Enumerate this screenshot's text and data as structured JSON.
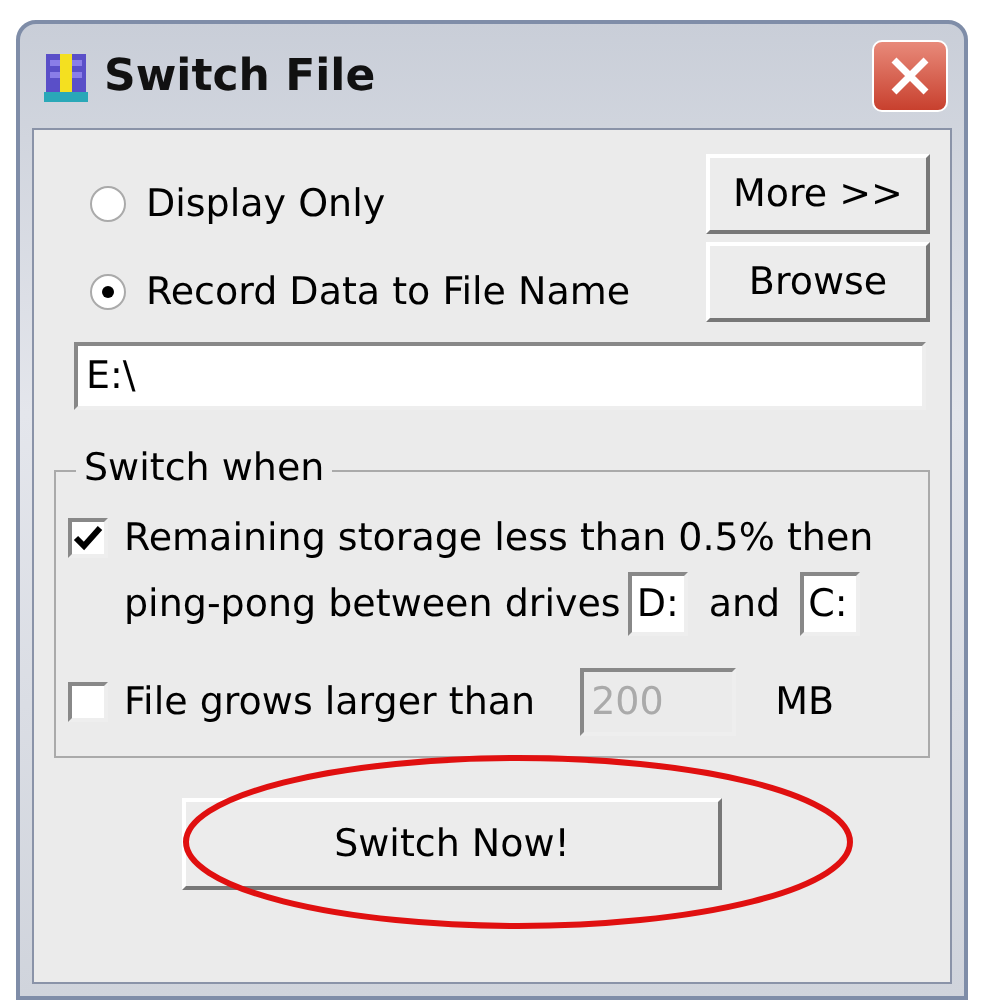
{
  "window": {
    "title": "Switch File"
  },
  "modes": [
    {
      "label": "Display Only",
      "selected": false
    },
    {
      "label": "Record Data to File Name",
      "selected": true
    }
  ],
  "side_buttons": [
    "More >>",
    "Browse"
  ],
  "file_name": {
    "value": "E:\\"
  },
  "switch_when": {
    "title": "Switch when",
    "storage": {
      "checked": true,
      "label": "Remaining storage less than 0.5% then",
      "label_2": "ping-pong between drives",
      "drive_1": "D:",
      "joiner": "and",
      "drive_2": "C:"
    },
    "size": {
      "checked": false,
      "label": "File grows larger than",
      "value": "200",
      "disabled": true,
      "unit": "MB"
    }
  },
  "switch_button": {
    "label": "Switch Now!",
    "highlighted": true
  }
}
